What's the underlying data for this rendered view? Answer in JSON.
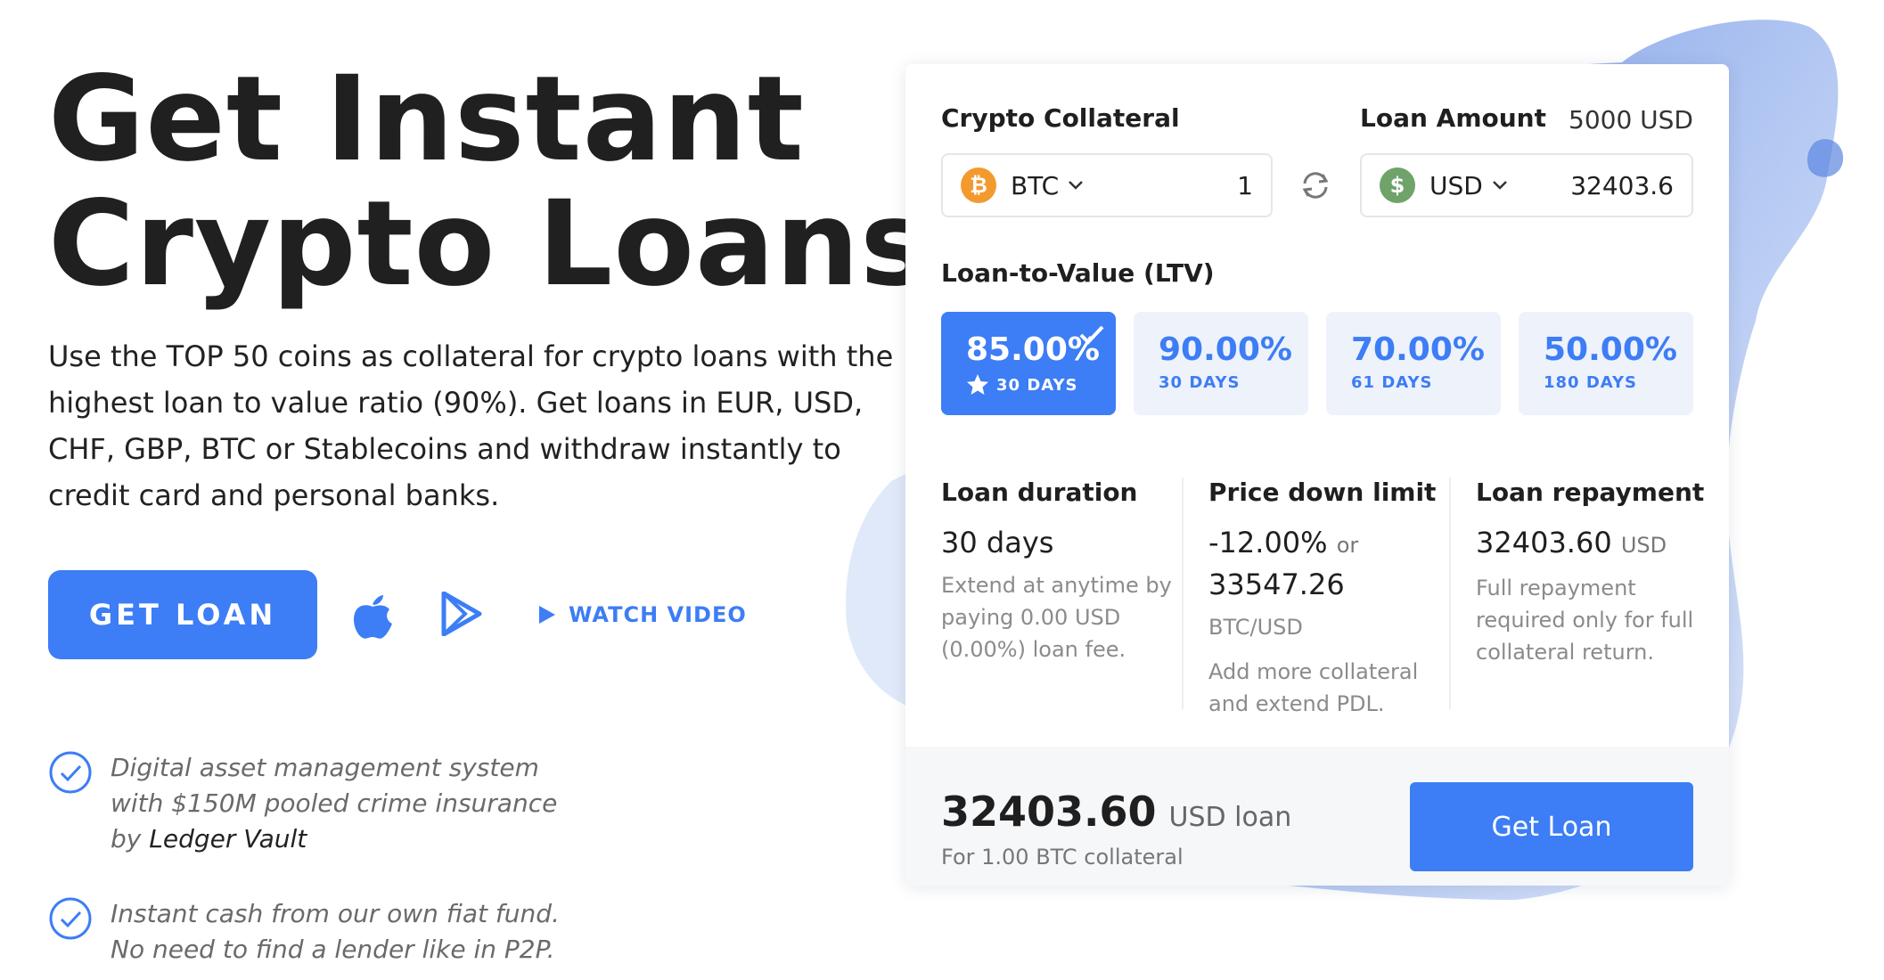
{
  "hero": {
    "title_line1": "Get Instant",
    "title_line2": "Crypto Loans",
    "description": "Use the TOP 50 coins as collateral for crypto loans with the highest loan to value ratio (90%). Get loans in EUR, USD, CHF, GBP, BTC or Stablecoins and withdraw instantly to credit card and personal banks.",
    "cta_label": "GET LOAN",
    "watch_video_label": "WATCH VIDEO",
    "icons": {
      "ios": "apple-icon",
      "android": "google-play-icon"
    }
  },
  "features": [
    {
      "text_before": "Digital asset management system with $150M pooled crime insurance by ",
      "emphasis": "Ledger Vault"
    },
    {
      "text": "Instant cash from our own fiat fund. No need to find a lender like in P2P."
    }
  ],
  "calculator": {
    "collateral_label": "Crypto Collateral",
    "loan_amount_label": "Loan Amount",
    "loan_amount_hint": "5000 USD",
    "collateral": {
      "ticker": "BTC",
      "value": "1",
      "icon": "bitcoin-icon",
      "color": "#f39a2e"
    },
    "loan": {
      "ticker": "USD",
      "value": "32403.6",
      "icon": "dollar-icon",
      "color": "#6fa36a"
    },
    "ltv_label": "Loan-to-Value (LTV)",
    "ltv_options": [
      {
        "pct": "85.00%",
        "days": "30 DAYS",
        "active": true
      },
      {
        "pct": "90.00%",
        "days": "30 DAYS",
        "active": false
      },
      {
        "pct": "70.00%",
        "days": "61 DAYS",
        "active": false
      },
      {
        "pct": "50.00%",
        "days": "180 DAYS",
        "active": false
      }
    ],
    "duration": {
      "heading": "Loan duration",
      "value": "30 days",
      "note": "Extend at anytime by paying 0.00 USD (0.00%) loan fee."
    },
    "price_down": {
      "heading": "Price down limit",
      "value": "-12.00%",
      "or": "or",
      "value2": "33547.26",
      "pair": "BTC/USD",
      "note": "Add more collateral and extend PDL."
    },
    "repayment": {
      "heading": "Loan repayment",
      "value": "32403.60",
      "unit": "USD",
      "note": "Full repayment required only for full collateral return."
    },
    "total": {
      "amount": "32403.60",
      "unit": "USD loan",
      "sub": "For 1.00 BTC collateral"
    },
    "submit_label": "Get Loan"
  },
  "colors": {
    "accent": "#3d7df5",
    "tile_bg": "#eef2fb"
  }
}
